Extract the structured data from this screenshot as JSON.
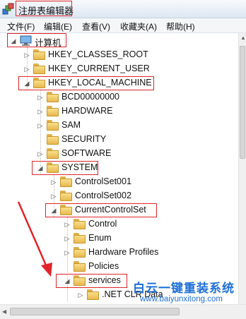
{
  "window": {
    "title": "注册表编辑器"
  },
  "menu": [
    "文件(F)",
    "编辑(E)",
    "查看(V)",
    "收藏夹(A)",
    "帮助(H)"
  ],
  "tree": {
    "root": "计算机",
    "hkcr": "HKEY_CLASSES_ROOT",
    "hkcu": "HKEY_CURRENT_USER",
    "hklm": "HKEY_LOCAL_MACHINE",
    "bcd": "BCD00000000",
    "hardware": "HARDWARE",
    "sam": "SAM",
    "security": "SECURITY",
    "software": "SOFTWARE",
    "system": "SYSTEM",
    "cs001": "ControlSet001",
    "cs002": "ControlSet002",
    "ccs": "CurrentControlSet",
    "control": "Control",
    "enum": "Enum",
    "hwprofiles": "Hardware Profiles",
    "policies": "Policies",
    "services": "services",
    "netclr": ".NET CLR Data"
  },
  "watermark": {
    "title": "白云一键重装系统",
    "url": "www.baiyunxitong.com"
  },
  "colors": {
    "highlight": "#e0242a",
    "watermark": "#1f6fd6",
    "folder": "#f4cf6a"
  }
}
